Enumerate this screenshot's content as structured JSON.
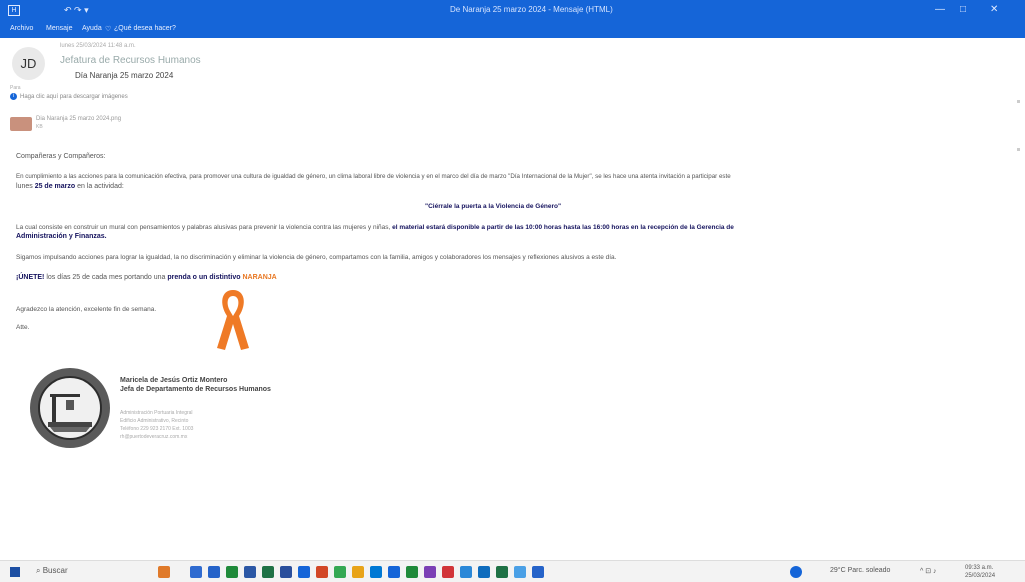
{
  "titlebar": {
    "save_glyph": "H",
    "quick_access": "↶  ↷  ▾",
    "title": "De Naranja 25 marzo 2024  -  Mensaje (HTML)",
    "min": "—",
    "max": "□",
    "close": "✕"
  },
  "ribbon": {
    "archivo": "Archivo",
    "mensaje": "Mensaje",
    "ayuda": "Ayuda",
    "tell_me": "¿Qué desea hacer?"
  },
  "email": {
    "avatar_initials": "JD",
    "date_line": "lunes 25/03/2024 11:48 a.m.",
    "from": "Jefatura de Recursos Humanos",
    "subject": "Día Naranja 25 marzo 2024",
    "to_line": "Para",
    "info_text": "Haga clic aquí para descargar imágenes",
    "attachment_name": "Dia Naranja 25 marzo 2024.png",
    "attachment_size": "KB"
  },
  "body": {
    "greeting": "Compañeras y Compañeros:",
    "para1_line1": "En cumplimiento a las acciones para la comunicación efectiva, para promover una cultura de igualdad de género, un clima laboral libre de violencia y en el marco del día de marzo \"Día Internacional de la Mujer\", se les hace una atenta invitación a participar este",
    "para1_line2_pre": "lunes",
    "para1_date": "25 de marzo",
    "para1_line2_post": "en la actividad:",
    "slogan": "\"Ciérrale la puerta a la Violencia de Género\"",
    "para2_pre": "La cual consiste en construir un mural con pensamientos y palabras alusivas para prevenir la violencia contra las mujeres y niñas,",
    "para2_bold": "el material estará disponible a partir de las 10:00 horas hasta las 16:00 horas en la recepción de la Gerencia de",
    "para2_line2": "Administración y Finanzas.",
    "para3": "Sigamos impulsando acciones para lograr la igualdad, la no discriminación y eliminar la violencia de género, compartamos con la familia, amigos y colaboradores los mensajes y reflexiones alusivos a este día.",
    "cta_pre": "¡ÚNETE!",
    "cta_mid": "los días 25 de cada mes portando una",
    "cta_bold": "prenda o un distintivo",
    "cta_orange": "NARANJA",
    "thanks": "Agradezco la atención, excelente fin de semana.",
    "closing": "Atte."
  },
  "signature": {
    "name": "Maricela de Jesús Ortiz Montero",
    "title": "Jefa de Departamento de Recursos Humanos",
    "line1": "Administración Portuaria Integral",
    "line2": "Edificio Administrativo, Recinto",
    "line3": "Teléfono 229 923 2170 Ext. 1003",
    "line4": "rh@puertodeveracruz.com.mx"
  },
  "taskbar": {
    "search": "Buscar",
    "weather": "29°C Parc. soleado",
    "tray": "^  ⊡  ♪",
    "time": "09:33 a.m.",
    "date": "25/03/2024"
  },
  "colors": {
    "accent": "#1565d8",
    "navy": "#15135e",
    "orange": "#e87722"
  }
}
